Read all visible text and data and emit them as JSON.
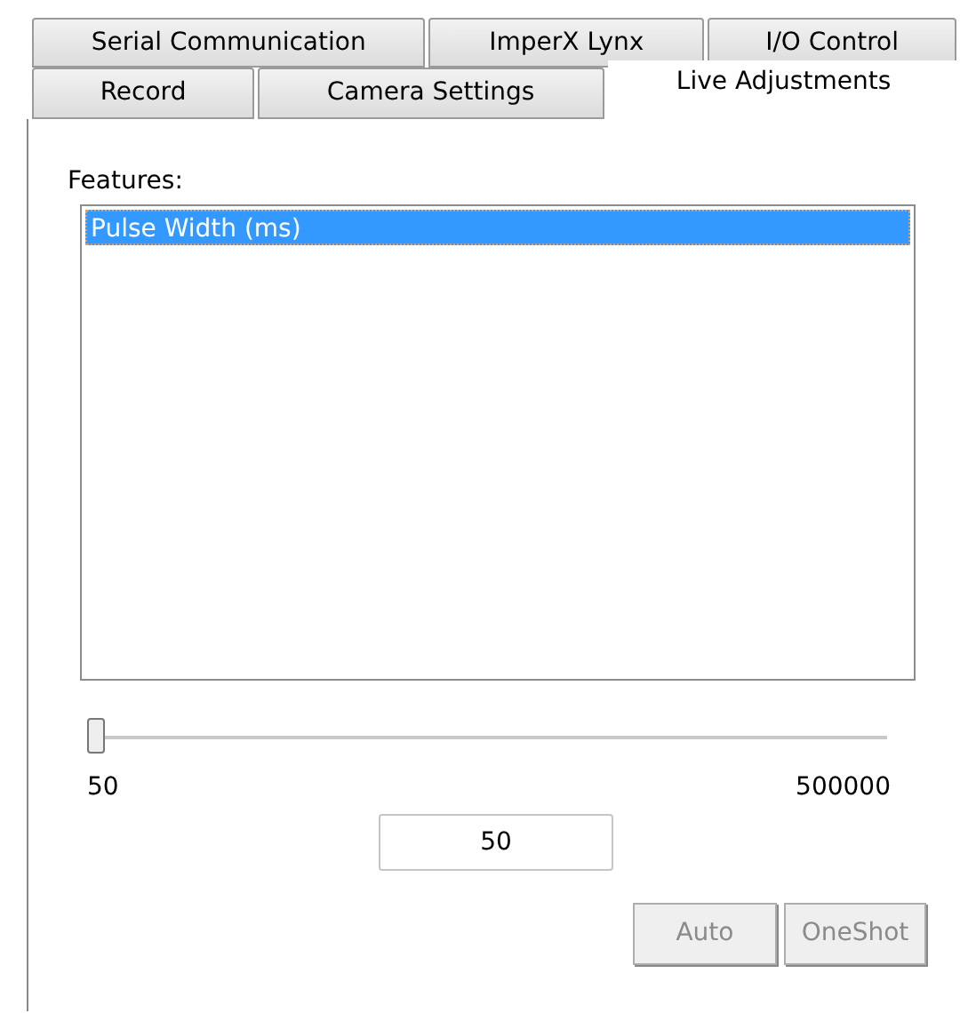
{
  "tab_rows": [
    [
      {
        "label": "Serial Communication",
        "selected": false
      },
      {
        "label": "ImperX Lynx",
        "selected": false
      },
      {
        "label": "I/O Control",
        "selected": false
      }
    ],
    [
      {
        "label": "Record",
        "selected": false
      },
      {
        "label": "Camera Settings",
        "selected": false
      },
      {
        "label": "Live Adjustments",
        "selected": true
      }
    ]
  ],
  "features": {
    "label": "Features:",
    "items": [
      {
        "label": "Pulse Width (ms)",
        "selected": true
      }
    ]
  },
  "slider": {
    "level": 0,
    "min_label": "50",
    "max_label": "500000"
  },
  "value_field": {
    "value": "50"
  },
  "buttons": [
    {
      "label": "Auto",
      "disabled": true
    },
    {
      "label": "OneShot",
      "disabled": true
    }
  ]
}
